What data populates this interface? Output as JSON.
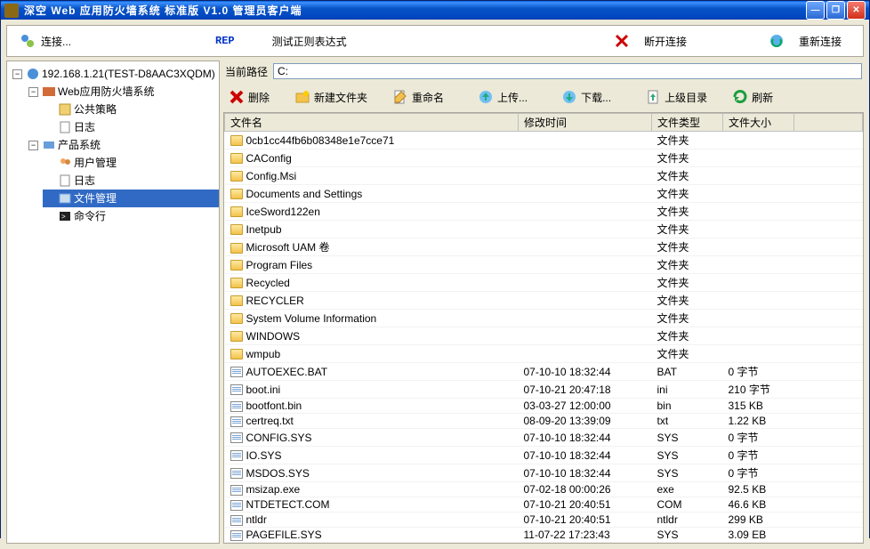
{
  "window": {
    "title": "深空 Web 应用防火墙系统 标准版 V1.0 管理员客户端"
  },
  "toolbar": {
    "connect": "连接...",
    "rep": "REP",
    "test_regex": "测试正则表达式",
    "disconnect": "断开连接",
    "reconnect": "重新连接"
  },
  "tree": {
    "root": "192.168.1.21(TEST-D8AAC3XQDM)",
    "waf": "Web应用防火墙系统",
    "public_policy": "公共策略",
    "log1": "日志",
    "product": "产品系统",
    "user_mgmt": "用户管理",
    "log2": "日志",
    "file_mgmt": "文件管理",
    "cmd": "命令行"
  },
  "path": {
    "label": "当前路径",
    "value": "C:"
  },
  "filetb": {
    "delete": "删除",
    "newfolder": "新建文件夹",
    "rename": "重命名",
    "upload": "上传...",
    "download": "下载...",
    "updir": "上级目录",
    "refresh": "刷新"
  },
  "columns": {
    "name": "文件名",
    "mtime": "修改时间",
    "type": "文件类型",
    "size": "文件大小"
  },
  "files": [
    {
      "name": "0cb1cc44fb6b08348e1e7cce71",
      "mtime": "",
      "type": "文件夹",
      "size": "",
      "icon": "folder"
    },
    {
      "name": "CAConfig",
      "mtime": "",
      "type": "文件夹",
      "size": "",
      "icon": "folder"
    },
    {
      "name": "Config.Msi",
      "mtime": "",
      "type": "文件夹",
      "size": "",
      "icon": "folder"
    },
    {
      "name": "Documents and Settings",
      "mtime": "",
      "type": "文件夹",
      "size": "",
      "icon": "folder"
    },
    {
      "name": "IceSword122en",
      "mtime": "",
      "type": "文件夹",
      "size": "",
      "icon": "folder"
    },
    {
      "name": "Inetpub",
      "mtime": "",
      "type": "文件夹",
      "size": "",
      "icon": "folder"
    },
    {
      "name": "Microsoft UAM 卷",
      "mtime": "",
      "type": "文件夹",
      "size": "",
      "icon": "folder"
    },
    {
      "name": "Program Files",
      "mtime": "",
      "type": "文件夹",
      "size": "",
      "icon": "folder"
    },
    {
      "name": "Recycled",
      "mtime": "",
      "type": "文件夹",
      "size": "",
      "icon": "folder"
    },
    {
      "name": "RECYCLER",
      "mtime": "",
      "type": "文件夹",
      "size": "",
      "icon": "folder"
    },
    {
      "name": "System Volume Information",
      "mtime": "",
      "type": "文件夹",
      "size": "",
      "icon": "folder"
    },
    {
      "name": "WINDOWS",
      "mtime": "",
      "type": "文件夹",
      "size": "",
      "icon": "folder"
    },
    {
      "name": "wmpub",
      "mtime": "",
      "type": "文件夹",
      "size": "",
      "icon": "folder"
    },
    {
      "name": "AUTOEXEC.BAT",
      "mtime": "07-10-10 18:32:44",
      "type": "BAT",
      "size": "0 字节",
      "icon": "file"
    },
    {
      "name": "boot.ini",
      "mtime": "07-10-21 20:47:18",
      "type": "ini",
      "size": "210 字节",
      "icon": "file"
    },
    {
      "name": "bootfont.bin",
      "mtime": "03-03-27 12:00:00",
      "type": "bin",
      "size": "315 KB",
      "icon": "file"
    },
    {
      "name": "certreq.txt",
      "mtime": "08-09-20 13:39:09",
      "type": "txt",
      "size": "1.22 KB",
      "icon": "file"
    },
    {
      "name": "CONFIG.SYS",
      "mtime": "07-10-10 18:32:44",
      "type": "SYS",
      "size": "0 字节",
      "icon": "file"
    },
    {
      "name": "IO.SYS",
      "mtime": "07-10-10 18:32:44",
      "type": "SYS",
      "size": "0 字节",
      "icon": "file"
    },
    {
      "name": "MSDOS.SYS",
      "mtime": "07-10-10 18:32:44",
      "type": "SYS",
      "size": "0 字节",
      "icon": "file"
    },
    {
      "name": "msizap.exe",
      "mtime": "07-02-18 00:00:26",
      "type": "exe",
      "size": "92.5 KB",
      "icon": "file"
    },
    {
      "name": "NTDETECT.COM",
      "mtime": "07-10-21 20:40:51",
      "type": "COM",
      "size": "46.6 KB",
      "icon": "file"
    },
    {
      "name": "ntldr",
      "mtime": "07-10-21 20:40:51",
      "type": "ntldr",
      "size": "299 KB",
      "icon": "file"
    },
    {
      "name": "PAGEFILE.SYS",
      "mtime": "11-07-22 17:23:43",
      "type": "SYS",
      "size": "3.09 EB",
      "icon": "file"
    }
  ]
}
